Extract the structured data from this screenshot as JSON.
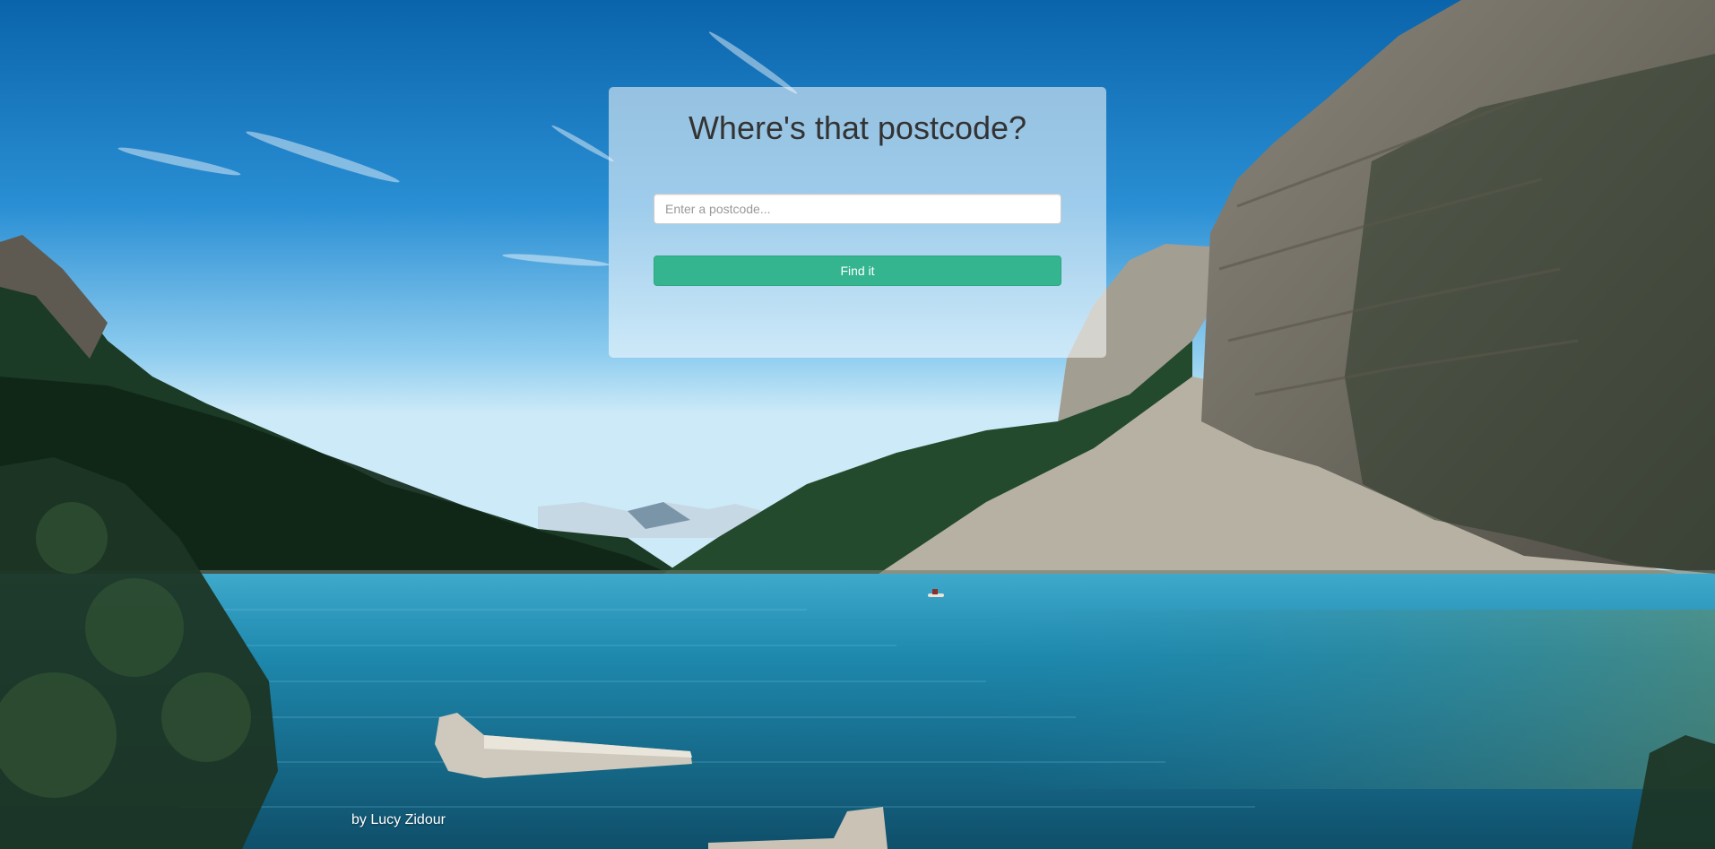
{
  "background": {
    "description_icon": "mountain-lake-photo",
    "colors": {
      "sky_top": "#0f6fb4",
      "sky_bottom": "#bfe3f7",
      "water": "#1b82a6",
      "forest": "#16301e",
      "cliff": "#7d7a6f",
      "scree": "#b6b0a3"
    }
  },
  "card": {
    "title": "Where's that postcode?",
    "input": {
      "value": "",
      "placeholder": "Enter a postcode..."
    },
    "button_label": "Find it",
    "button_color": "#34b58f"
  },
  "footer": {
    "credit": "by Lucy Zidour"
  }
}
